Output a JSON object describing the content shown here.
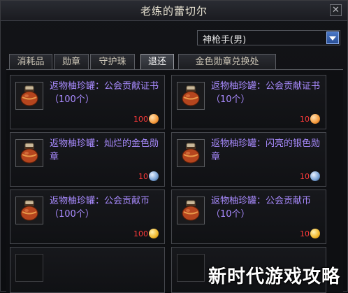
{
  "window": {
    "title": "老练的蕾切尔"
  },
  "selector": {
    "value": "神枪手(男)"
  },
  "tabs": [
    {
      "label": "消耗品"
    },
    {
      "label": "勋章"
    },
    {
      "label": "守护珠"
    },
    {
      "label": "退还"
    },
    {
      "label": "金色勋章兑换处"
    }
  ],
  "active_tab": "退还",
  "items": [
    {
      "name": "返物柚珍罐：公会贡献证书（100个）",
      "price": "100",
      "currency_icon": "certificate-coin-icon"
    },
    {
      "name": "返物柚珍罐：公会贡献证书（10个）",
      "price": "10",
      "currency_icon": "certificate-coin-icon"
    },
    {
      "name": "返物柚珍罐：灿烂的金色勋章",
      "price": "10",
      "currency_icon": "medal-coin-icon"
    },
    {
      "name": "返物柚珍罐：闪亮的银色勋章",
      "price": "10",
      "currency_icon": "medal-coin-icon"
    },
    {
      "name": "返物柚珍罐：公会贡献币（100个）",
      "price": "100",
      "currency_icon": "gold-coin-icon"
    },
    {
      "name": "返物柚珍罐：公会贡献币（10个）",
      "price": "10",
      "currency_icon": "gold-coin-icon"
    }
  ],
  "watermark": "新时代游戏攻略",
  "colors": {
    "item_name": "#a98bff",
    "price": "#ff3a3a",
    "dropdown_button": "#3a64b4"
  }
}
